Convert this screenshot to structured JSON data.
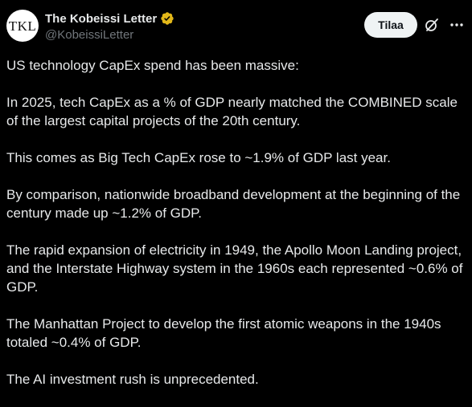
{
  "author": {
    "avatar_text": "TKL",
    "display_name": "The Kobeissi Letter",
    "handle": "@KobeissiLetter",
    "verified_color": "#e2b719"
  },
  "header": {
    "subscribe_label": "Tilaa",
    "icons": [
      "grok-icon",
      "more-icon"
    ]
  },
  "post": {
    "paragraphs": [
      "US technology CapEx spend has been massive:",
      "In 2025, tech CapEx as a % of GDP nearly matched the COMBINED scale of the largest capital projects of the 20th century.",
      "This comes as Big Tech CapEx rose to ~1.9% of GDP last year.",
      "By comparison, nationwide broadband development at the beginning of the century made up ~1.2% of GDP.",
      "The rapid expansion of electricity in 1949, the Apollo Moon Landing project, and the Interstate Highway system in the 1960s each represented ~0.6% of GDP.",
      "The Manhattan Project to develop the first atomic weapons in the 1940s totaled ~0.4% of GDP.",
      "The AI investment rush is unprecedented."
    ]
  },
  "colors": {
    "background": "#000000",
    "text": "#e7e9ea",
    "secondary_text": "#71767b",
    "button_bg": "#eff3f4"
  }
}
